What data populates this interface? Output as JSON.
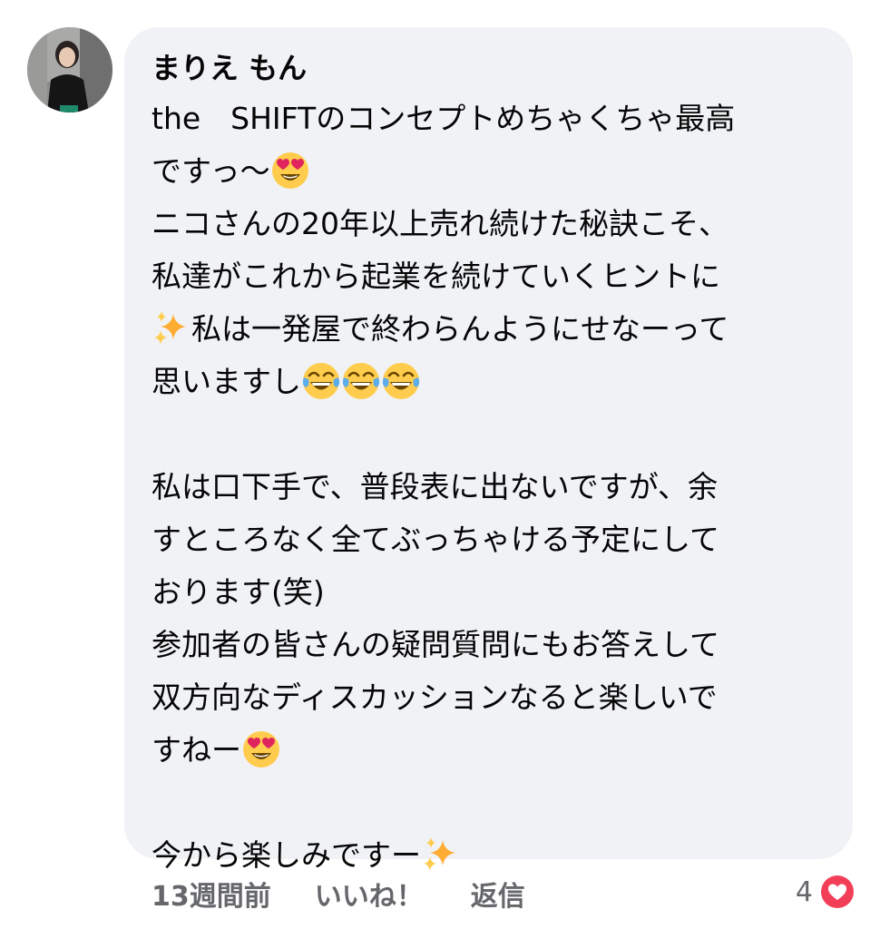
{
  "comment": {
    "author": "まりえ もん",
    "lines": [
      {
        "text": "the　SHIFTのコンセプトめちゃくちゃ最高",
        "emojis": []
      },
      {
        "text": "ですっ〜",
        "emojis": [
          "heart-eyes"
        ]
      },
      {
        "text": "ニコさんの20年以上売れ続けた秘訣こそ、",
        "emojis": []
      },
      {
        "text": "私達がこれから起業を続けていくヒントに",
        "emojis": []
      },
      {
        "prefix_emoji": "sparkles",
        "text": "私は一発屋で終わらんようにせなーって",
        "emojis": []
      },
      {
        "text": "思いますし",
        "emojis": [
          "tears-of-joy",
          "tears-of-joy",
          "tears-of-joy"
        ]
      },
      {
        "text": "",
        "emojis": []
      },
      {
        "text": "私は口下手で、普段表に出ないですが、余",
        "emojis": []
      },
      {
        "text": "すところなく全てぶっちゃける予定にして",
        "emojis": []
      },
      {
        "text": "おります(笑)",
        "emojis": []
      },
      {
        "text": "参加者の皆さんの疑問質問にもお答えして",
        "emojis": []
      },
      {
        "text": "双方向なディスカッションなると楽しいで",
        "emojis": []
      },
      {
        "text": "すねー",
        "emojis": [
          "heart-eyes"
        ]
      },
      {
        "text": "",
        "emojis": []
      },
      {
        "text": "今から楽しみですー",
        "emojis": [
          "sparkles"
        ]
      }
    ]
  },
  "actions": {
    "time": "13週間前",
    "like_label": "いいね！",
    "reply_label": "返信"
  },
  "reactions": {
    "count": "4",
    "icon": "heart-reaction-icon"
  },
  "colors": {
    "bubble_bg": "#f0f2f5",
    "text": "#050505",
    "meta_text": "#65676b",
    "heart": "#f33e58"
  }
}
